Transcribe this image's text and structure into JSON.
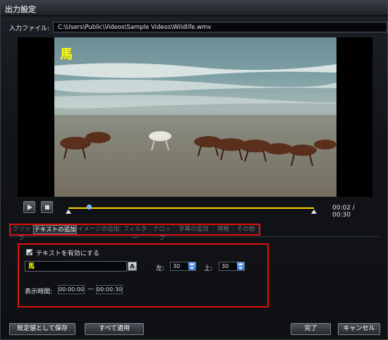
{
  "window": {
    "title": "出力設定"
  },
  "input": {
    "label": "入力ファイル:",
    "path": "C:\\Users\\Public\\Videos\\Sample Videos\\Wildlife.wmv"
  },
  "preview": {
    "overlay_text": "馬"
  },
  "player": {
    "time_readout": "00:02 / 00:30",
    "progress": 0.08,
    "play_icon": "play-icon",
    "stop_icon": "stop-icon"
  },
  "tabs": [
    {
      "label": "クリップ",
      "active": false
    },
    {
      "label": "テキストの追加",
      "active": true
    },
    {
      "label": "イメージの追加",
      "active": false
    },
    {
      "label": "フィルター",
      "active": false
    },
    {
      "label": "クロップ",
      "active": false
    },
    {
      "label": "字幕の追加",
      "active": false
    },
    {
      "label": "規格",
      "active": false
    },
    {
      "label": "その他",
      "active": false
    }
  ],
  "text_settings": {
    "enable_label": "テキストを有効にする",
    "enabled": true,
    "text_value": "馬",
    "font_button": "A",
    "left_label": "左:",
    "left_value": "30",
    "top_label": "上:",
    "top_value": "30",
    "duration_label": "表示時間:",
    "start_time": "00:00:00",
    "dash": "—",
    "end_time": "00:00:30"
  },
  "buttons": {
    "save_default": "既定値として保存",
    "apply_all": "すべて適用",
    "done": "完了",
    "cancel": "キャンセル"
  },
  "colors": {
    "highlight_border": "#e01010",
    "overlay_text": "#ffff00",
    "timeline": "#ffd400"
  }
}
